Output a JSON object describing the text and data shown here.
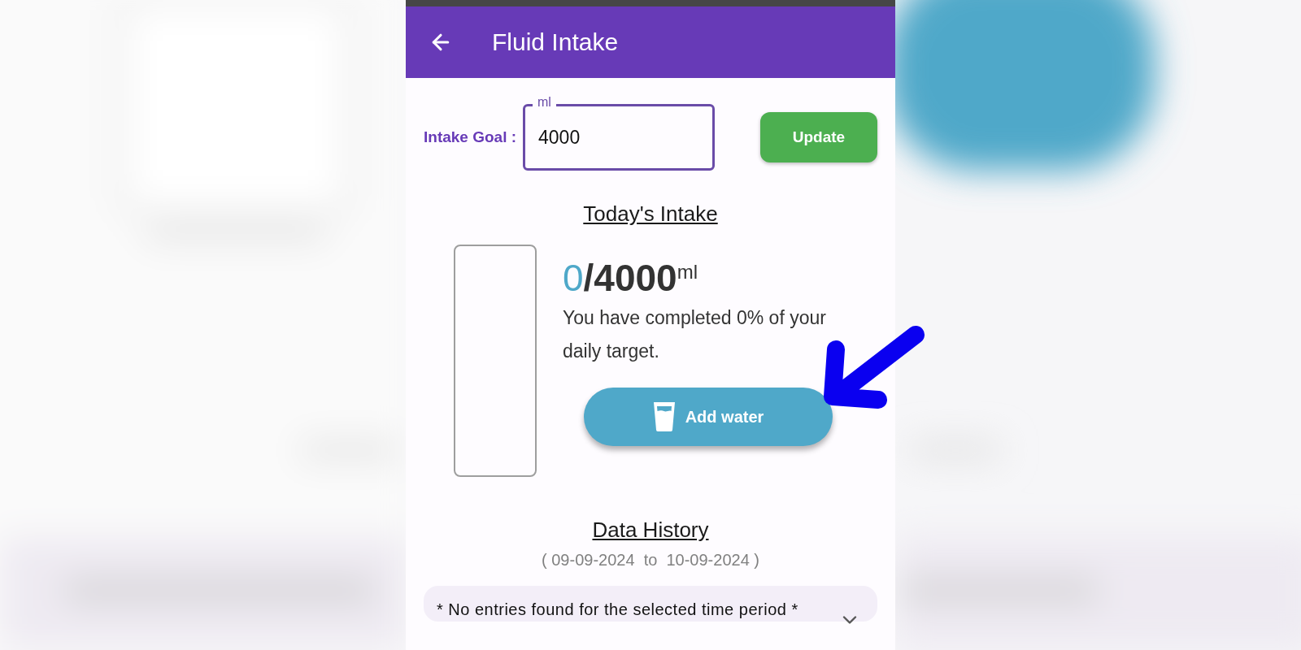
{
  "app_bar": {
    "title": "Fluid Intake"
  },
  "goal": {
    "label": "Intake Goal :",
    "field_label": "ml",
    "value": "4000",
    "button": "Update"
  },
  "today": {
    "heading": "Today's Intake",
    "consumed": "0",
    "target": "/4000",
    "unit": "ml",
    "message": "You have completed 0% of your daily target.",
    "button": "Add water",
    "glass": {
      "level": 0
    }
  },
  "history": {
    "heading": "Data History",
    "range": "( 09-09-2024  to  10-09-2024 )",
    "notice": "* No entries found for the selected time period *"
  }
}
